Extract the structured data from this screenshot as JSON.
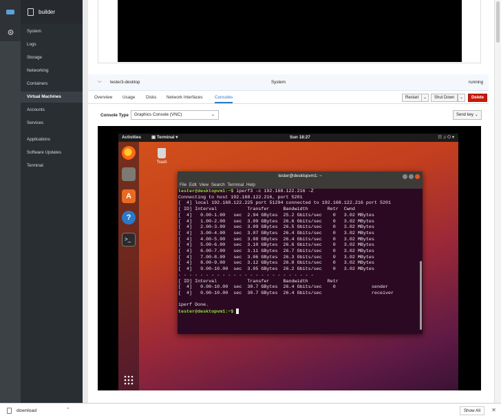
{
  "host": {
    "name": "builder"
  },
  "sidebar": {
    "items": [
      {
        "label": "System"
      },
      {
        "label": "Logs"
      },
      {
        "label": "Storage"
      },
      {
        "label": "Networking"
      },
      {
        "label": "Containers"
      },
      {
        "label": "Virtual Machines"
      },
      {
        "label": "Accounts"
      },
      {
        "label": "Services"
      },
      {
        "label": "Applications"
      },
      {
        "label": "Software Updates"
      },
      {
        "label": "Terminal"
      }
    ]
  },
  "vm": {
    "name": "tester3-desktop",
    "connection": "System",
    "state": "running"
  },
  "tabs": [
    "Overview",
    "Usage",
    "Disks",
    "Network Interfaces",
    "Consoles"
  ],
  "actions": {
    "restart": "Restart",
    "shutdown": "Shut Down",
    "delete": "Delete"
  },
  "console": {
    "type_label": "Console Type",
    "type_value": "Graphics Console (VNC)",
    "send_key": "Send key"
  },
  "desktop": {
    "activities": "Activities",
    "app": "Terminal",
    "clock": "Sun 18:27",
    "trash": "Trash"
  },
  "terminal": {
    "title": "tester@desktopvm1: ~",
    "menu": [
      "File",
      "Edit",
      "View",
      "Search",
      "Terminal",
      "Help"
    ],
    "prompt": "tester@desktopvm1:~$",
    "command": " iperf3 -c 192.168.122.216 -Z",
    "lines": [
      "Connecting to host 192.168.122.216, port 5201",
      "[  4] local 192.168.122.225 port 51294 connected to 192.168.122.216 port 5201",
      "[ ID] Interval           Transfer     Bandwidth       Retr  Cwnd",
      "[  4]   0.00-1.00   sec  2.94 GBytes  25.2 Gbits/sec    0   3.02 MBytes",
      "[  4]   1.00-2.00   sec  3.09 GBytes  26.6 Gbits/sec    0   3.02 MBytes",
      "[  4]   2.00-3.00   sec  3.09 GBytes  26.5 Gbits/sec    0   3.02 MBytes",
      "[  4]   3.00-4.00   sec  3.07 GBytes  26.4 Gbits/sec    0   3.02 MBytes",
      "[  4]   4.00-5.00   sec  3.08 GBytes  26.4 Gbits/sec    0   3.02 MBytes",
      "[  4]   5.00-6.00   sec  3.10 GBytes  26.6 Gbits/sec    0   3.02 MBytes",
      "[  4]   6.00-7.00   sec  3.11 GBytes  26.7 Gbits/sec    0   3.02 MBytes",
      "[  4]   7.00-8.00   sec  3.06 GBytes  26.3 Gbits/sec    0   3.02 MBytes",
      "[  4]   8.00-9.00   sec  3.12 GBytes  26.8 Gbits/sec    0   3.02 MBytes",
      "[  4]   9.00-10.00  sec  3.05 GBytes  26.2 Gbits/sec    0   3.02 MBytes",
      "- - - - - - - - - - - - - - - - - - - - - - - - -",
      "[ ID] Interval           Transfer     Bandwidth       Retr",
      "[  4]   0.00-10.00  sec  30.7 GBytes  26.4 Gbits/sec    0             sender",
      "[  4]   0.00-10.00  sec  30.7 GBytes  26.4 Gbits/sec                  receiver",
      "",
      "iperf Done."
    ]
  },
  "download": {
    "filename": "download",
    "show_all": "Show All"
  }
}
